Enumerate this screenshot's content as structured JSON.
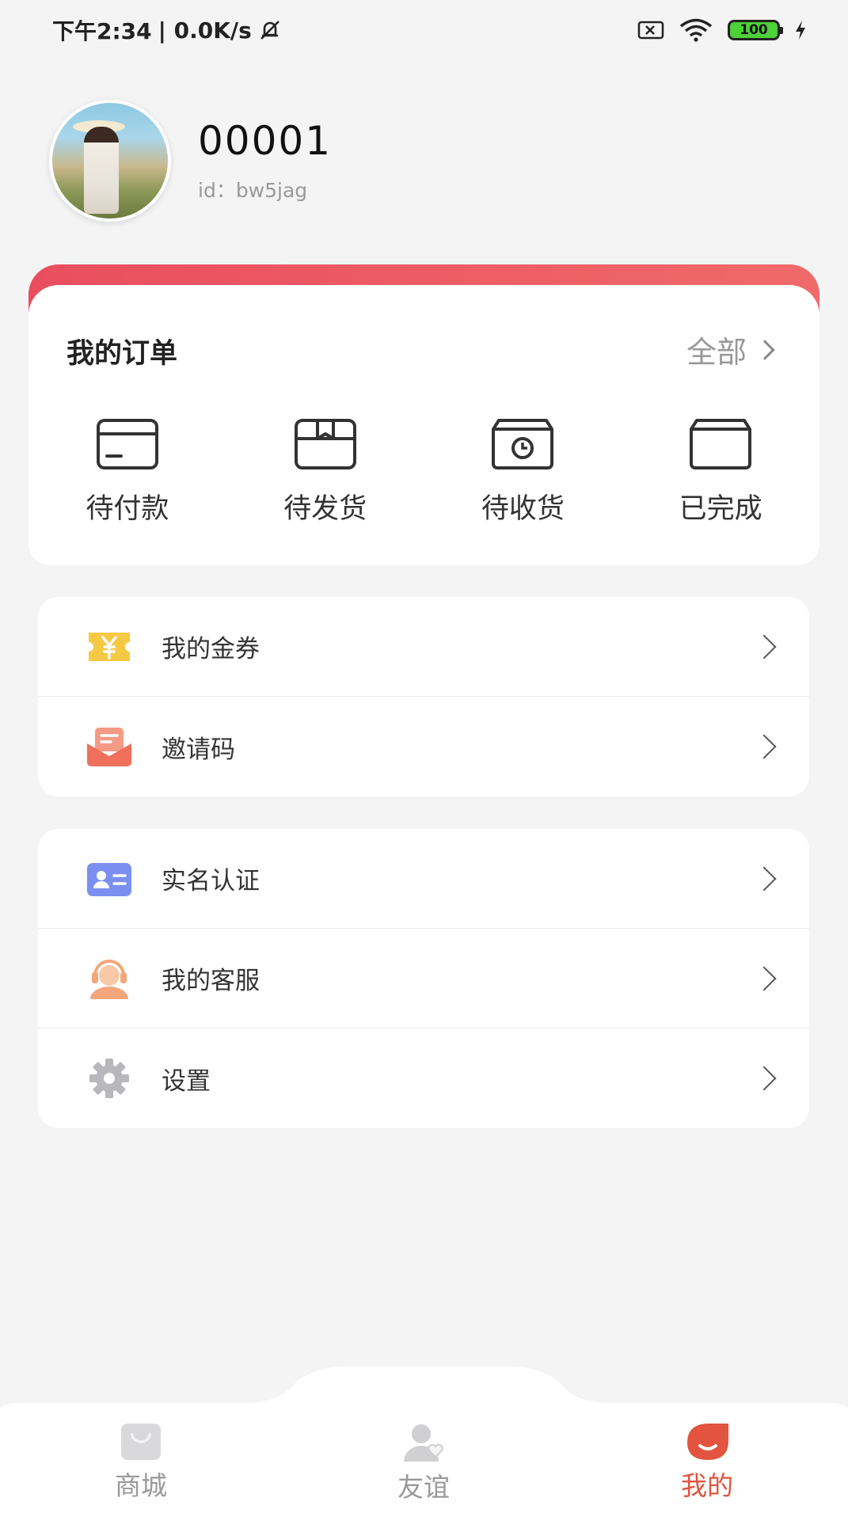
{
  "status_bar": {
    "time": "下午2:34",
    "speed": "| 0.0K/s",
    "battery": "100",
    "icons": [
      "mute-icon",
      "sim-off-icon",
      "wifi-icon",
      "battery-icon",
      "charging-icon"
    ]
  },
  "profile": {
    "username": "00001",
    "id_text": "id：bw5jag"
  },
  "orders": {
    "title": "我的订单",
    "all_label": "全部",
    "items": [
      {
        "label": "待付款",
        "icon": "card-icon"
      },
      {
        "label": "待发货",
        "icon": "package-icon"
      },
      {
        "label": "待收货",
        "icon": "delivery-box-icon"
      },
      {
        "label": "已完成",
        "icon": "completed-box-icon"
      }
    ]
  },
  "menu_group_1": [
    {
      "label": "我的金券",
      "icon": "coupon-icon"
    },
    {
      "label": "邀请码",
      "icon": "invite-envelope-icon"
    }
  ],
  "menu_group_2": [
    {
      "label": "实名认证",
      "icon": "id-card-icon"
    },
    {
      "label": "我的客服",
      "icon": "customer-service-icon"
    },
    {
      "label": "设置",
      "icon": "gear-icon"
    }
  ],
  "bottom_nav": [
    {
      "label": "商城",
      "icon": "shop-bag-icon",
      "active": false
    },
    {
      "label": "友谊",
      "icon": "friend-icon",
      "active": false
    },
    {
      "label": "我的",
      "icon": "profile-drop-icon",
      "active": true
    }
  ],
  "colors": {
    "accent_red": "#e94e5e",
    "active_tab": "#e2543f",
    "coupon_yellow": "#f6c945",
    "invite_red": "#f0705b",
    "id_blue": "#7b8ff0",
    "service_orange": "#f2a77a",
    "gear_gray": "#b8b8bc"
  }
}
